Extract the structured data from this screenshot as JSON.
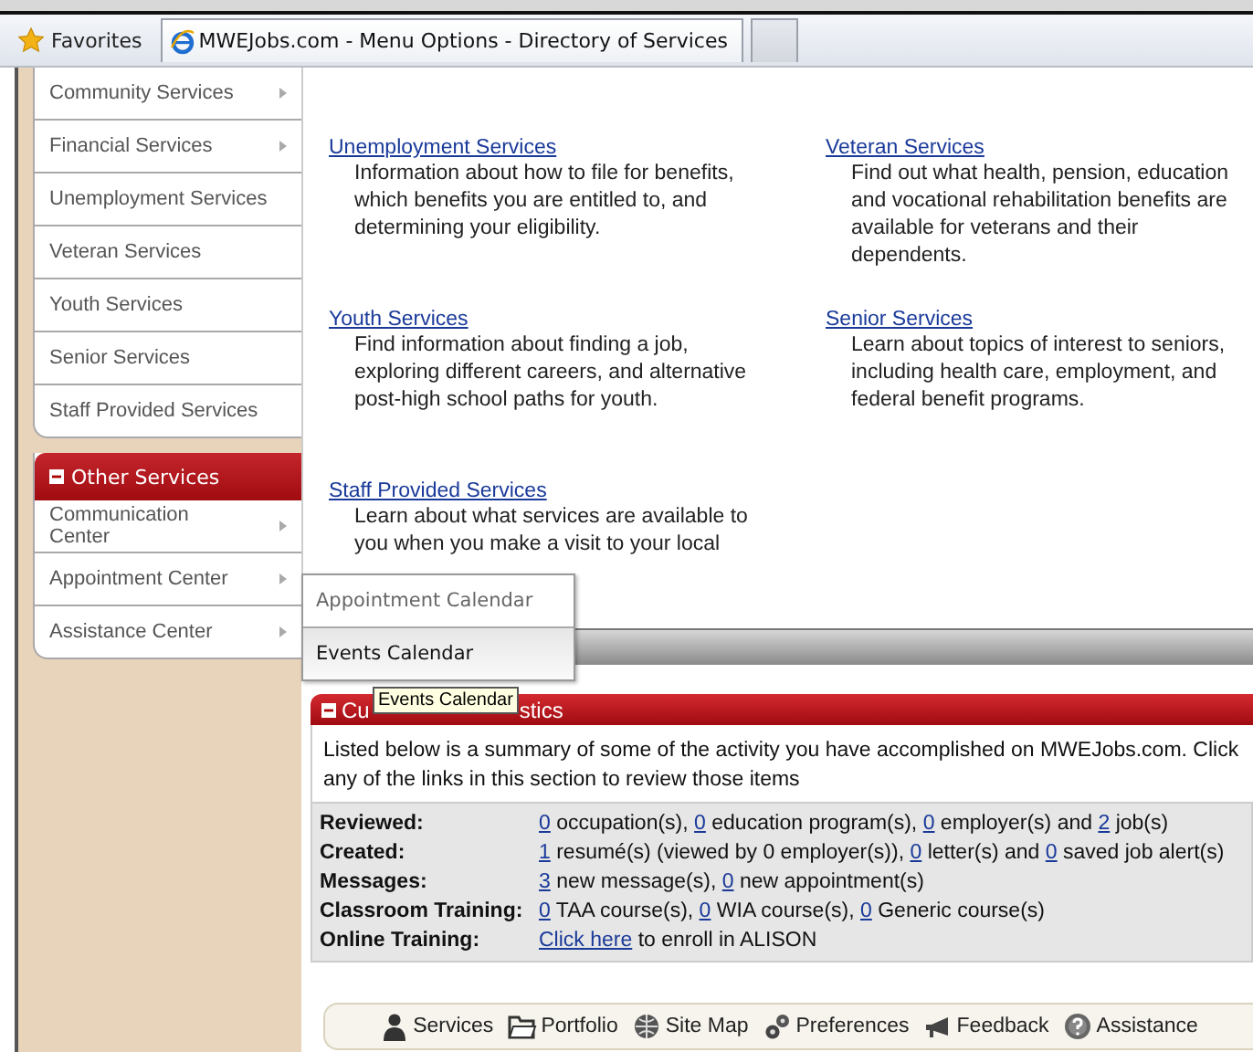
{
  "favorites_bar": {
    "favorites_label": "Favorites",
    "tabs": [
      {
        "title": "MWEJobs.com - Menu Options - Directory of Services",
        "selected": true
      },
      {
        "selected": false
      }
    ]
  },
  "sidebar": {
    "groups": [
      {
        "items": [
          {
            "label": "Community Services",
            "has_submenu": true
          },
          {
            "label": "Financial Services",
            "has_submenu": true
          },
          {
            "label": "Unemployment Services",
            "has_submenu": false
          },
          {
            "label": "Veteran Services",
            "has_submenu": false
          },
          {
            "label": "Youth Services",
            "has_submenu": false
          },
          {
            "label": "Senior Services",
            "has_submenu": false
          },
          {
            "label": "Staff Provided Services",
            "has_submenu": false
          }
        ]
      },
      {
        "title": "Other Services",
        "expanded": true,
        "items": [
          {
            "label": "Communication Center",
            "has_submenu": true
          },
          {
            "label": "Appointment Center",
            "has_submenu": true
          },
          {
            "label": "Assistance Center",
            "has_submenu": true
          }
        ]
      }
    ]
  },
  "submenu": {
    "items": [
      {
        "label": "Appointment Calendar",
        "highlighted": false
      },
      {
        "label": "Events Calendar",
        "highlighted": true
      }
    ]
  },
  "tooltip": "Events Calendar",
  "services": [
    {
      "title": "Unemployment Services",
      "description": "Information about how to file for benefits, which benefits you are entitled to, and determining your eligibility."
    },
    {
      "title": "Veteran Services",
      "description": "Find out what health, pension, education and vocational rehabilitation benefits are available for veterans and their dependents."
    },
    {
      "title": "Youth Services",
      "description": "Find information about finding a job, exploring different careers, and alternative post-high school paths for youth."
    },
    {
      "title": "Senior Services",
      "description": "Learn about topics of interest to seniors, including health care, employment, and federal benefit programs."
    },
    {
      "title": "Staff Provided Services",
      "description": "Learn about what services are available to you when you make a visit to your local"
    }
  ],
  "statistics": {
    "title_start": "Cu",
    "title_end": "stics",
    "expanded": true,
    "intro": [
      "Listed below is a summary of some of the activity you have accomplished on MWEJobs.com. Click",
      "any of the links in this section to review those items"
    ],
    "rows": [
      {
        "label": "Reviewed:",
        "parts": [
          {
            "text": "0",
            "link": true
          },
          {
            "text": " occupation(s), ",
            "link": false
          },
          {
            "text": "0",
            "link": true
          },
          {
            "text": " education program(s), ",
            "link": false
          },
          {
            "text": "0",
            "link": true
          },
          {
            "text": " employer(s) and ",
            "link": false
          },
          {
            "text": "2",
            "link": true
          },
          {
            "text": " job(s)",
            "link": false
          }
        ]
      },
      {
        "label": "Created:",
        "parts": [
          {
            "text": "1",
            "link": true
          },
          {
            "text": " resumé(s) (viewed by 0 employer(s)), ",
            "link": false
          },
          {
            "text": "0",
            "link": true
          },
          {
            "text": " letter(s) and ",
            "link": false
          },
          {
            "text": "0",
            "link": true
          },
          {
            "text": " saved job alert(s)",
            "link": false
          }
        ]
      },
      {
        "label": "Messages:",
        "parts": [
          {
            "text": "3",
            "link": true
          },
          {
            "text": " new message(s), ",
            "link": false
          },
          {
            "text": "0",
            "link": true
          },
          {
            "text": " new appointment(s)",
            "link": false
          }
        ]
      },
      {
        "label": "Classroom Training:",
        "parts": [
          {
            "text": "0",
            "link": true
          },
          {
            "text": " TAA course(s), ",
            "link": false
          },
          {
            "text": "0",
            "link": true
          },
          {
            "text": " WIA course(s), ",
            "link": false
          },
          {
            "text": "0",
            "link": true
          },
          {
            "text": " Generic course(s)",
            "link": false
          }
        ]
      },
      {
        "label": "Online Training:",
        "parts": [
          {
            "text": "Click here",
            "link": true
          },
          {
            "text": " to enroll in ALISON",
            "link": false
          }
        ]
      }
    ]
  },
  "footer_links": [
    {
      "kind": "person",
      "label": "Services"
    },
    {
      "kind": "folder",
      "label": "Portfolio"
    },
    {
      "kind": "globe",
      "label": "Site Map"
    },
    {
      "kind": "gears",
      "label": "Preferences"
    },
    {
      "kind": "megaphone",
      "label": "Feedback"
    },
    {
      "kind": "help",
      "label": "Assistance"
    }
  ]
}
